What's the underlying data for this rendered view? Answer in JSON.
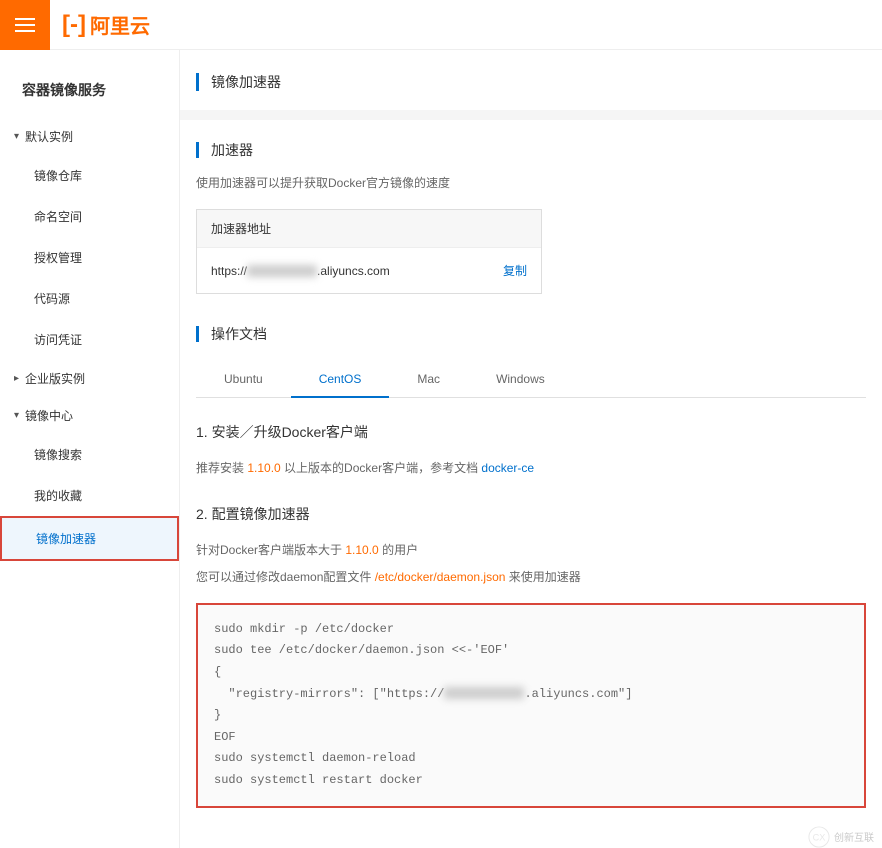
{
  "header": {
    "logo_text": "阿里云"
  },
  "sidebar": {
    "title": "容器镜像服务",
    "groups": [
      {
        "label": "默认实例",
        "items": [
          {
            "label": "镜像仓库"
          },
          {
            "label": "命名空间"
          },
          {
            "label": "授权管理"
          },
          {
            "label": "代码源"
          },
          {
            "label": "访问凭证"
          }
        ]
      },
      {
        "label": "企业版实例",
        "collapsed": true,
        "items": []
      },
      {
        "label": "镜像中心",
        "items": [
          {
            "label": "镜像搜索"
          },
          {
            "label": "我的收藏"
          },
          {
            "label": "镜像加速器",
            "active": true
          }
        ]
      }
    ]
  },
  "page": {
    "title": "镜像加速器",
    "accelerator": {
      "heading": "加速器",
      "desc": "使用加速器可以提升获取Docker官方镜像的速度",
      "box_title": "加速器地址",
      "url_prefix": "https://",
      "url_suffix": ".aliyuncs.com",
      "copy_label": "复制"
    },
    "docs": {
      "heading": "操作文档",
      "tabs": [
        "Ubuntu",
        "CentOS",
        "Mac",
        "Windows"
      ],
      "active_tab": "CentOS",
      "step1_title": "1. 安装／升级Docker客户端",
      "step1_pre": "推荐安装 ",
      "step1_version": "1.10.0",
      "step1_post": " 以上版本的Docker客户端，参考文档 ",
      "step1_link": "docker-ce",
      "step2_title": "2. 配置镜像加速器",
      "step2_line1_pre": "针对Docker客户端版本大于 ",
      "step2_line1_ver": "1.10.0",
      "step2_line1_post": " 的用户",
      "step2_line2_pre": "您可以通过修改daemon配置文件 ",
      "step2_line2_path": "/etc/docker/daemon.json",
      "step2_line2_post": " 来使用加速器",
      "code": {
        "l1": "sudo mkdir -p /etc/docker",
        "l2": "sudo tee /etc/docker/daemon.json <<-'EOF'",
        "l3": "{",
        "l4a": "  \"registry-mirrors\": [\"https://",
        "l4b": ".aliyuncs.com\"]",
        "l5": "}",
        "l6": "EOF",
        "l7": "sudo systemctl daemon-reload",
        "l8": "sudo systemctl restart docker"
      }
    }
  },
  "watermark": "创新互联"
}
